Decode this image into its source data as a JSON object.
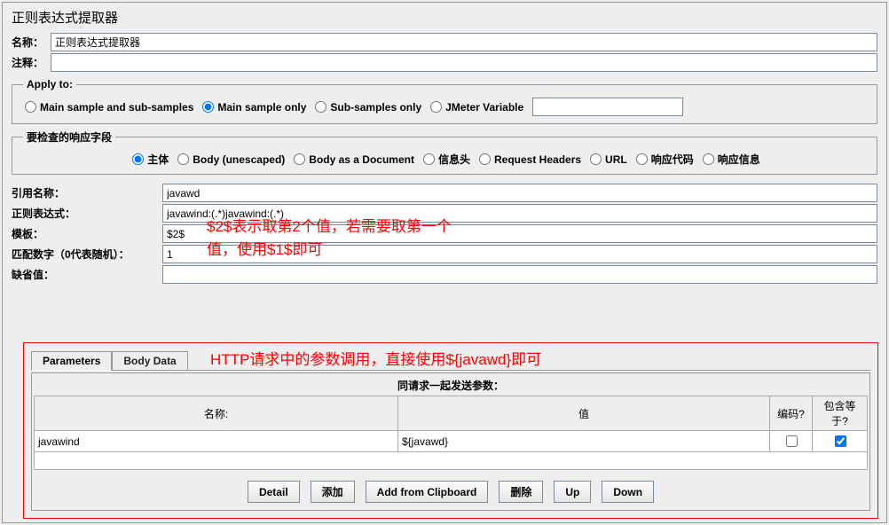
{
  "panel_title": "正则表达式提取器",
  "name_label": "名称：",
  "name_value": "正则表达式提取器",
  "comment_label": "注释：",
  "comment_value": "",
  "apply_to_legend": "Apply to:",
  "apply_to_options": {
    "main_sub": "Main sample and sub-samples",
    "main_only": "Main sample only",
    "sub_only": "Sub-samples only",
    "jmeter_var": "JMeter Variable"
  },
  "apply_to_selected": "main_only",
  "jmeter_var_value": "",
  "check_field_legend": "要检查的响应字段",
  "check_field_options": {
    "body": "主体",
    "body_unescaped": "Body (unescaped)",
    "body_doc": "Body as a Document",
    "headers_info": "信息头",
    "req_headers": "Request Headers",
    "url": "URL",
    "code": "响应代码",
    "message": "响应信息"
  },
  "check_field_selected": "body",
  "extractor": {
    "ref_name_label": "引用名称：",
    "ref_name_value": "javawd",
    "regex_label": "正则表达式：",
    "regex_value": "javawind:(.*)javawind:(.*)",
    "template_label": "模板：",
    "template_value": "$2$",
    "matchno_label": "匹配数字（0代表随机）：",
    "matchno_value": "1",
    "default_label": "缺省值：",
    "default_value": ""
  },
  "annotations": {
    "a1_line1": "$2$表示取第2个值，若需要取第一个",
    "a1_line2": "值，使用$1$即可",
    "a2": "HTTP请求中的参数调用，直接使用${javawd}即可"
  },
  "params": {
    "tab1": "Parameters",
    "tab2": "Body Data",
    "title": "同请求一起发送参数：",
    "col_name": "名称:",
    "col_value": "值",
    "col_encode": "编码?",
    "col_eq": "包含等于?",
    "rows": [
      {
        "name": "javawind",
        "value": "${javawd}",
        "encode": false,
        "eq": true
      }
    ],
    "buttons": {
      "detail": "Detail",
      "add": "添加",
      "add_clip": "Add from Clipboard",
      "delete": "删除",
      "up": "Up",
      "down": "Down"
    }
  }
}
